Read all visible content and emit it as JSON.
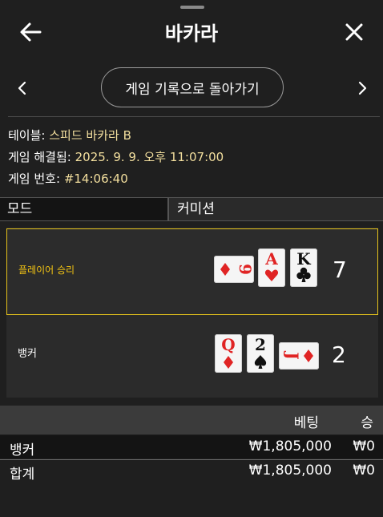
{
  "header": {
    "title": "바카라",
    "back_icon": "arrow-left-icon",
    "close_icon": "close-icon"
  },
  "nav": {
    "history_button": "게임 기록으로 돌아가기",
    "prev_icon": "chevron-left-icon",
    "next_icon": "chevron-right-icon"
  },
  "info": {
    "table_label": "테이블:",
    "table_value": "스피드 바카라 B",
    "resolved_label": "게임 해결됨:",
    "resolved_value": "2025. 9. 9. 오후 11:07:00",
    "game_no_label": "게임 번호:",
    "game_no_value": "#14:06:40"
  },
  "columns": {
    "mode": "모드",
    "commission": "커미션"
  },
  "rounds": {
    "player": {
      "label": "플레이어 승리",
      "score": "7",
      "cards": [
        {
          "rank": "9",
          "suit": "diamond",
          "orientation": "horizontal"
        },
        {
          "rank": "A",
          "suit": "heart",
          "orientation": "vertical"
        },
        {
          "rank": "K",
          "suit": "club",
          "orientation": "vertical"
        }
      ]
    },
    "banker": {
      "label": "뱅커",
      "score": "2",
      "cards": [
        {
          "rank": "Q",
          "suit": "diamond",
          "orientation": "vertical"
        },
        {
          "rank": "2",
          "suit": "spade",
          "orientation": "vertical"
        },
        {
          "rank": "J",
          "suit": "diamond",
          "orientation": "horizontal"
        }
      ]
    }
  },
  "totals": {
    "header": {
      "bet": "베팅",
      "win": "승"
    },
    "rows": [
      {
        "label": "뱅커",
        "bet": "₩1,805,000",
        "win": "₩0"
      },
      {
        "label": "합계",
        "bet": "₩1,805,000",
        "win": "₩0"
      }
    ]
  },
  "colors": {
    "background": "#1f1f1f",
    "highlight": "#e6c31c",
    "info_value": "#f3df9e",
    "card_red": "#e02424",
    "card_black": "#111111"
  }
}
